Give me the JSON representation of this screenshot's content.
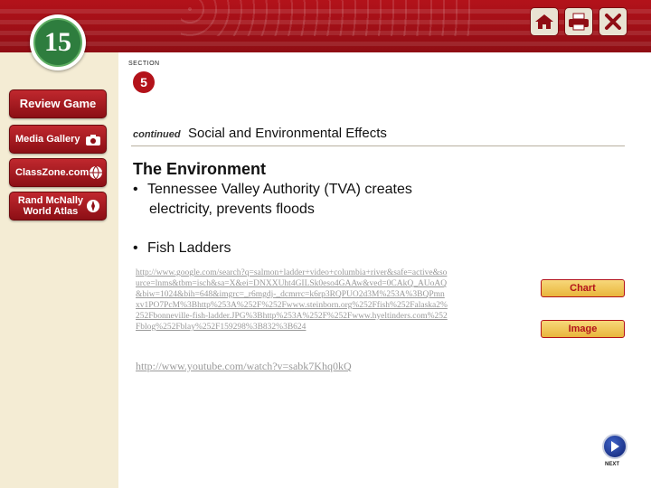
{
  "chapter": {
    "number": "15"
  },
  "top_icons": [
    {
      "icon": "home-icon"
    },
    {
      "icon": "print-icon"
    },
    {
      "icon": "close-icon"
    }
  ],
  "sidebar": {
    "items": [
      {
        "label": "Review Game",
        "icon": ""
      },
      {
        "label": "Media Gallery",
        "icon": "camera-icon"
      },
      {
        "label": "ClassZone.com",
        "icon": "globe-icon"
      },
      {
        "label": "Rand McNally World Atlas",
        "icon": "compass-icon"
      }
    ]
  },
  "section": {
    "label": "SECTION",
    "number": "5"
  },
  "title": {
    "continued": "continued",
    "text": "Social and Environmental Effects"
  },
  "heading": "The Environment",
  "bullets": [
    {
      "line1": "Tennessee Valley Authority (TVA) creates",
      "line2": "electricity, prevents floods"
    },
    {
      "line1": "Fish Ladders"
    }
  ],
  "links": {
    "google_url": "http://www.google.com/search?q=salmon+ladder+video+columbia+river&safe=active&source=lnms&tbm=isch&sa=X&ei=DNXXUht4GILSk0eso4GAAw&ved=0CAkQ_AUoAQ&biw=1024&bih=648&imgrc=_r6mgdj-_dcmrrc=k6rp3RQPUO2d3M%253A%3BQPmnxv1PO7PcM%3Bhttp%253A%252F%252Fwww.steinborn.org%252Ffish%252Falaska2%252Fbonneville-fish-ladder.JPG%3Bhttp%253A%252F%252Fwww.hyeltinders.com%252Fblog%252Fblay%252F159298%3B832%3B624",
    "youtube_url": "http://www.youtube.com/watch?v=sabk7Khq0kQ"
  },
  "buttons": {
    "chart": "Chart",
    "image": "Image"
  },
  "nav": {
    "next_label": "NEXT"
  },
  "colors": {
    "banner_red": "#b3121a",
    "chapter_green": "#2e7d3e",
    "button_gold": "#e9b53c",
    "next_blue": "#1a3187"
  }
}
